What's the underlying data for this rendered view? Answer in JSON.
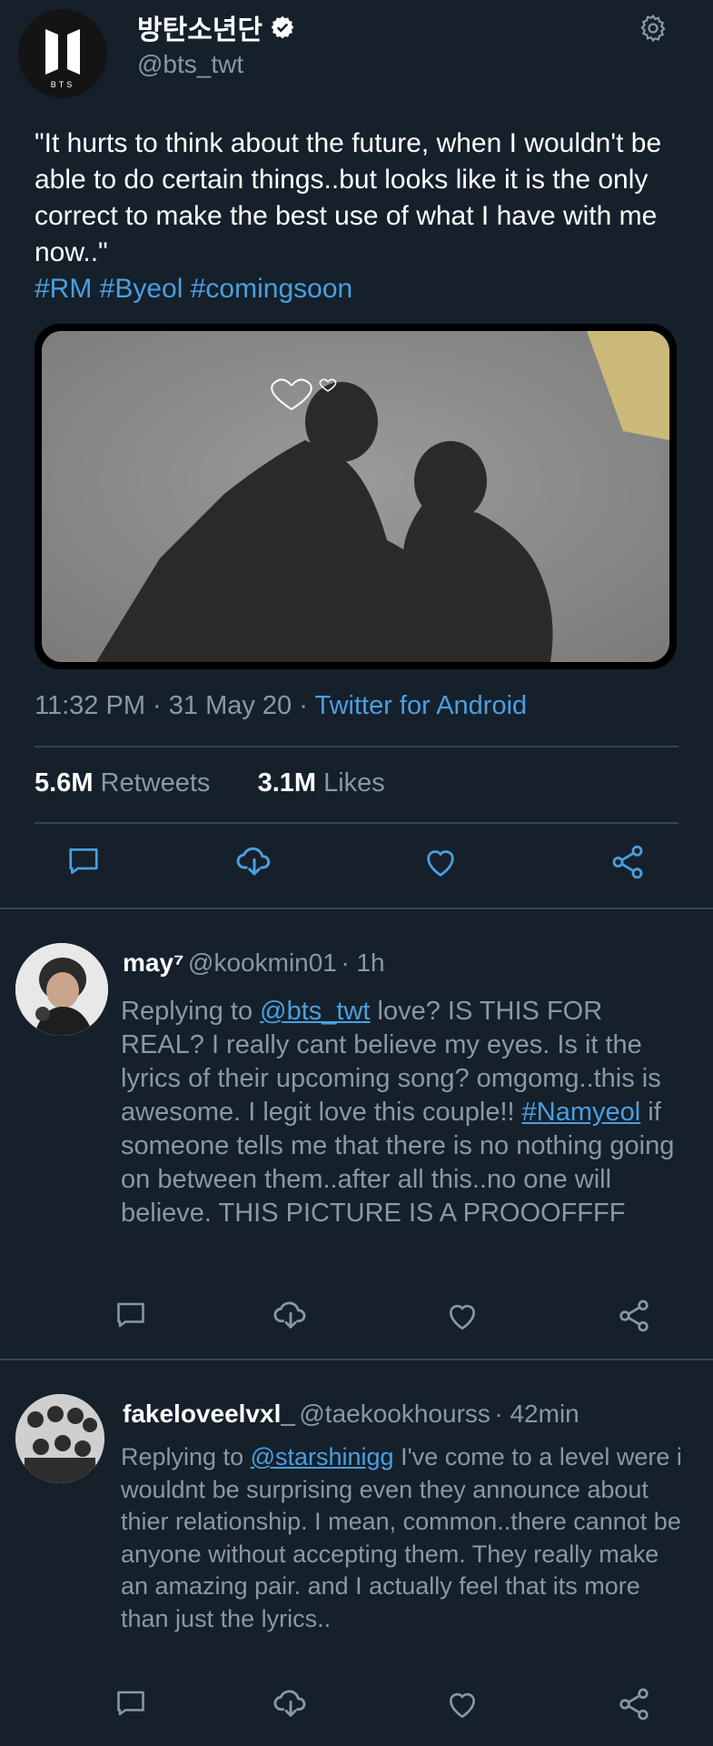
{
  "main_tweet": {
    "avatar_logo_text": "BTS",
    "display_name": "방탄소년단",
    "handle": "@bts_twt",
    "text": "\"It hurts to think about the future, when I wouldn't be able to do certain things..but looks like it is the only correct to make the best use of what I have with me now..\"",
    "hashtags": "#RM #Byeol #comingsoon",
    "time": "11:32 PM",
    "date": "31 May 20",
    "source": "Twitter for Android",
    "retweets_count": "5.6M",
    "retweets_label": "Retweets",
    "likes_count": "3.1M",
    "likes_label": "Likes"
  },
  "replies": [
    {
      "display_name": "may⁷",
      "handle": "@kookmin01",
      "time": "1h",
      "replying_prefix": "Replying to ",
      "replying_to": "@bts_twt",
      "text_before": " love? IS THIS FOR REAL? I really cant believe my eyes. Is it the lyrics of their upcoming song? omgomg..this is awesome.  I legit love this couple!! ",
      "hashtag": "#Namyeol",
      "text_after": " if someone tells me that there is no nothing going on between them..after all this..no one will believe.  THIS PICTURE IS A PROOOFFFF"
    },
    {
      "display_name": "fakeloveelvxl_",
      "handle": "@taekookhourss",
      "time": "42min",
      "replying_prefix": "Replying to ",
      "replying_to": "@starshinigg",
      "text_before": " I've come to a level were i wouldnt be surprising even they announce about thier relationship. I mean, common..there cannot be anyone without accepting them. They really make an amazing pair. and I actually feel that its more than just the lyrics.."
    }
  ],
  "colors": {
    "background": "#15202b",
    "accent": "#4a9fe0",
    "muted": "#8899a6",
    "divider": "#38444d"
  },
  "icons": [
    "gear-icon",
    "verified-badge-icon",
    "reply-icon",
    "download-icon",
    "heart-icon",
    "share-icon"
  ]
}
